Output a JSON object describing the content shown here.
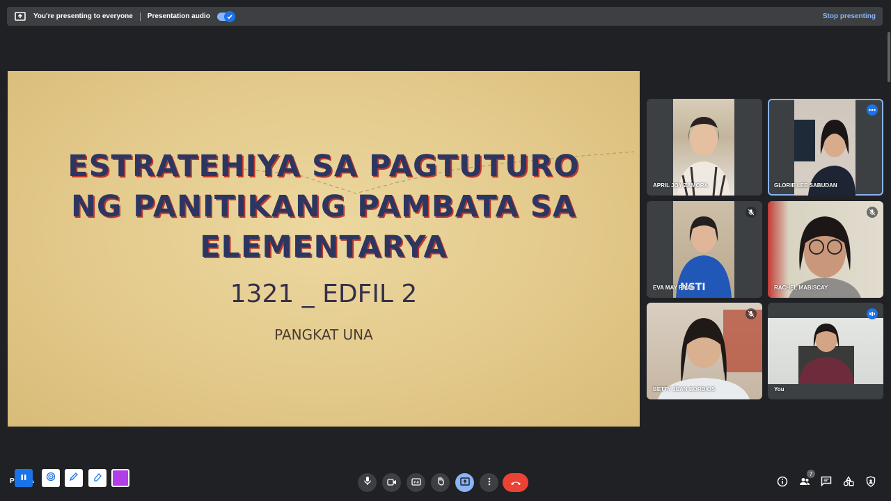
{
  "topbar": {
    "message": "You're presenting to everyone",
    "audio_label": "Presentation audio",
    "audio_enabled": true,
    "stop_label": "Stop presenting"
  },
  "slide": {
    "title_lines": [
      "ESTRATEHIYA SA PAGTUTURO",
      "NG PANITIKANG PAMBATA SA",
      "ELEMENTARYA"
    ],
    "subtitle": "1321 _ EDFIL 2",
    "group": "PANGKAT UNA"
  },
  "participants": [
    {
      "name": "APRIL JOY ZAMORA",
      "muted": false
    },
    {
      "name": "GLORIE LEE SABUDAN",
      "muted": false,
      "more_options": true
    },
    {
      "name": "EVA MAY PIYAL",
      "muted": true
    },
    {
      "name": "RACHEL MABISCAY",
      "muted": true
    },
    {
      "name": "BETTY JEAN BORDIOS",
      "muted": true
    },
    {
      "name": "You",
      "speaking": true
    }
  ],
  "controls": {
    "participant_count": "7",
    "end_call_color": "#ea4335",
    "present_color": "#8ab4f8"
  },
  "annotation": {
    "label_prefix": "P",
    "label_suffix": "KA",
    "color": "#b23ee8"
  },
  "icons": [
    "present-screen-icon",
    "check-icon",
    "mic-icon",
    "camera-icon",
    "captions-icon",
    "raise-hand-icon",
    "present-icon",
    "more-vert-icon",
    "end-call-icon",
    "info-icon",
    "people-icon",
    "chat-icon",
    "activities-icon",
    "host-controls-icon",
    "pause-icon",
    "spotlight-icon",
    "pen-icon",
    "eraser-icon",
    "more-horiz-icon",
    "mic-off-icon",
    "speaking-icon"
  ]
}
